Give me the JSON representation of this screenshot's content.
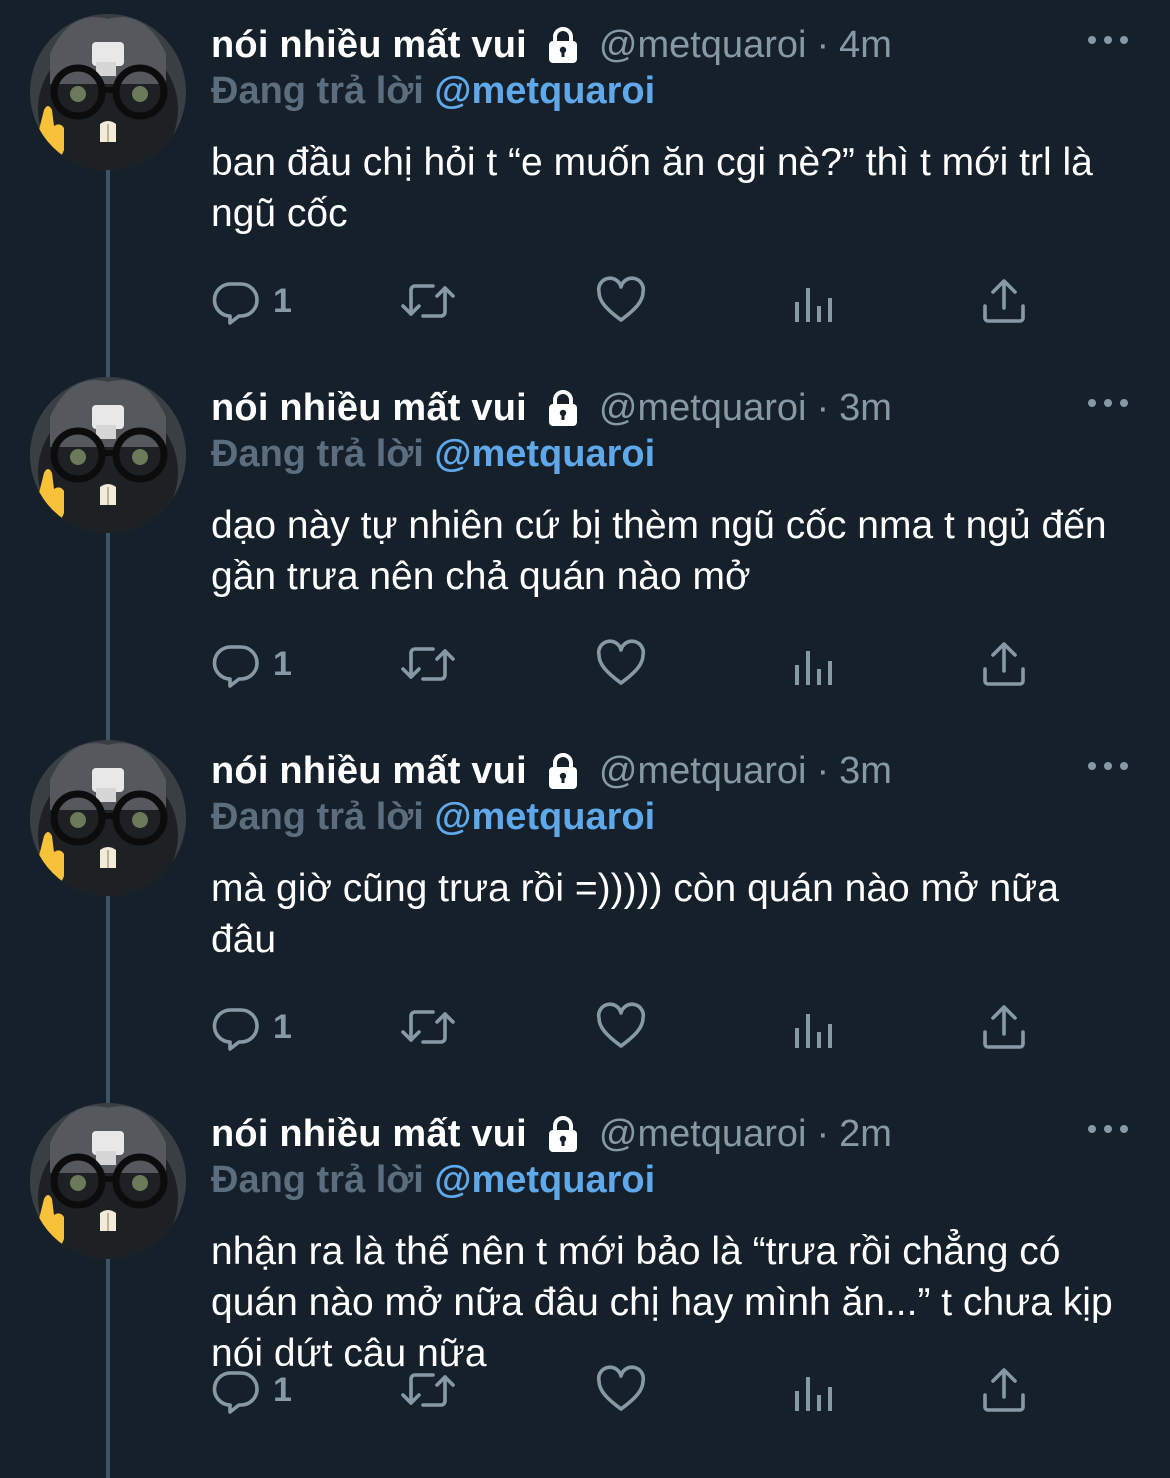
{
  "theme": {
    "background": "#15202b",
    "name_color": "#ffffff",
    "muted_color": "#8899a6",
    "reply_prefix_color": "#5c6e7e",
    "link_color": "#5fa8ea",
    "thread_line_color": "#3d5466"
  },
  "tweets": [
    {
      "name": "nói nhiều mất vui",
      "handle": "@metquaroi",
      "separator": "·",
      "time": "4m",
      "reply_prefix": "Đang trả lời",
      "reply_to": "@metquaroi",
      "text": "ban đầu chị hỏi t “e muốn ăn cgi nè?” thì t mới trl là ngũ cốc",
      "reply_count": "1",
      "icons": [
        "lock-icon",
        "more-icon",
        "reply-icon",
        "retweet-icon",
        "like-icon",
        "analytics-icon",
        "share-icon"
      ]
    },
    {
      "name": "nói nhiều mất vui",
      "handle": "@metquaroi",
      "separator": "·",
      "time": "3m",
      "reply_prefix": "Đang trả lời",
      "reply_to": "@metquaroi",
      "text": "dạo này tự nhiên cứ bị thèm ngũ cốc nma t ngủ đến gần trưa nên chả quán nào mở",
      "reply_count": "1",
      "icons": [
        "lock-icon",
        "more-icon",
        "reply-icon",
        "retweet-icon",
        "like-icon",
        "analytics-icon",
        "share-icon"
      ]
    },
    {
      "name": "nói nhiều mất vui",
      "handle": "@metquaroi",
      "separator": "·",
      "time": "3m",
      "reply_prefix": "Đang trả lời",
      "reply_to": "@metquaroi",
      "text": "mà giờ cũng trưa rồi =))))) còn quán nào mở nữa đâu",
      "reply_count": "1",
      "icons": [
        "lock-icon",
        "more-icon",
        "reply-icon",
        "retweet-icon",
        "like-icon",
        "analytics-icon",
        "share-icon"
      ]
    },
    {
      "name": "nói nhiều mất vui",
      "handle": "@metquaroi",
      "separator": "·",
      "time": "2m",
      "reply_prefix": "Đang trả lời",
      "reply_to": "@metquaroi",
      "text": "nhận ra là thế nên t mới bảo là “trưa rồi chẳng có quán nào mở nữa đâu chị hay mình ăn...” t chưa kịp nói dứt câu nữa",
      "reply_count": "1",
      "icons": [
        "lock-icon",
        "more-icon",
        "reply-icon",
        "retweet-icon",
        "like-icon",
        "analytics-icon",
        "share-icon"
      ]
    }
  ]
}
